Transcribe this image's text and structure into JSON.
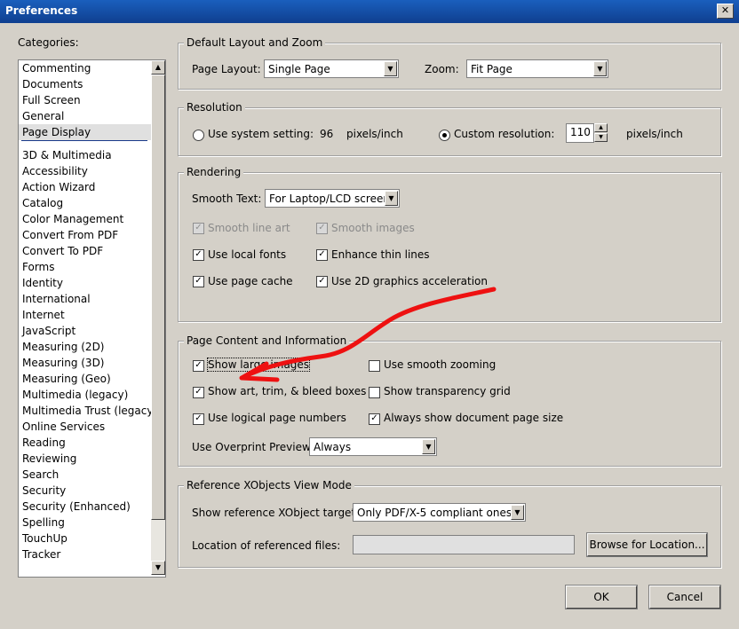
{
  "window": {
    "title": "Preferences",
    "close_glyph": "✕"
  },
  "categories": {
    "label": "Categories:",
    "group1": [
      "Commenting",
      "Documents",
      "Full Screen",
      "General",
      "Page Display"
    ],
    "group2": [
      "3D & Multimedia",
      "Accessibility",
      "Action Wizard",
      "Catalog",
      "Color Management",
      "Convert From PDF",
      "Convert To PDF",
      "Forms",
      "Identity",
      "International",
      "Internet",
      "JavaScript",
      "Measuring (2D)",
      "Measuring (3D)",
      "Measuring (Geo)",
      "Multimedia (legacy)",
      "Multimedia Trust (legacy)",
      "Online Services",
      "Reading",
      "Reviewing",
      "Search",
      "Security",
      "Security (Enhanced)",
      "Spelling",
      "TouchUp",
      "Tracker"
    ],
    "selected": "Page Display"
  },
  "layout": {
    "legend": "Default Layout and Zoom",
    "page_layout_label": "Page Layout:",
    "page_layout_value": "Single Page",
    "zoom_label": "Zoom:",
    "zoom_value": "Fit Page"
  },
  "resolution": {
    "legend": "Resolution",
    "system_label": "Use system setting:",
    "system_value": "96",
    "system_unit": "pixels/inch",
    "custom_label": "Custom resolution:",
    "custom_value": "110",
    "custom_unit": "pixels/inch"
  },
  "rendering": {
    "legend": "Rendering",
    "smooth_text_label": "Smooth Text:",
    "smooth_text_value": "For Laptop/LCD screens",
    "smooth_line_art": "Smooth line art",
    "smooth_images": "Smooth images",
    "local_fonts": "Use local fonts",
    "thin_lines": "Enhance thin lines",
    "page_cache": "Use page cache",
    "graphics_2d": "Use 2D graphics acceleration"
  },
  "content": {
    "legend": "Page Content and Information",
    "large_images": "Show large images",
    "smooth_zooming": "Use smooth zooming",
    "art_trim": "Show art, trim, & bleed boxes",
    "transparency_grid": "Show transparency grid",
    "logical_numbers": "Use logical page numbers",
    "doc_page_size": "Always show document page size",
    "overprint_label": "Use Overprint Preview:",
    "overprint_value": "Always"
  },
  "xobjects": {
    "legend": "Reference XObjects View Mode",
    "targets_label": "Show reference XObject targets:",
    "targets_value": "Only PDF/X-5 compliant ones",
    "location_label": "Location of referenced files:",
    "location_value": "",
    "browse_label": "Browse for Location..."
  },
  "footer": {
    "ok": "OK",
    "cancel": "Cancel"
  },
  "colors": {
    "annotation": "#ee1111",
    "titlebar": "#1a5fbd"
  }
}
